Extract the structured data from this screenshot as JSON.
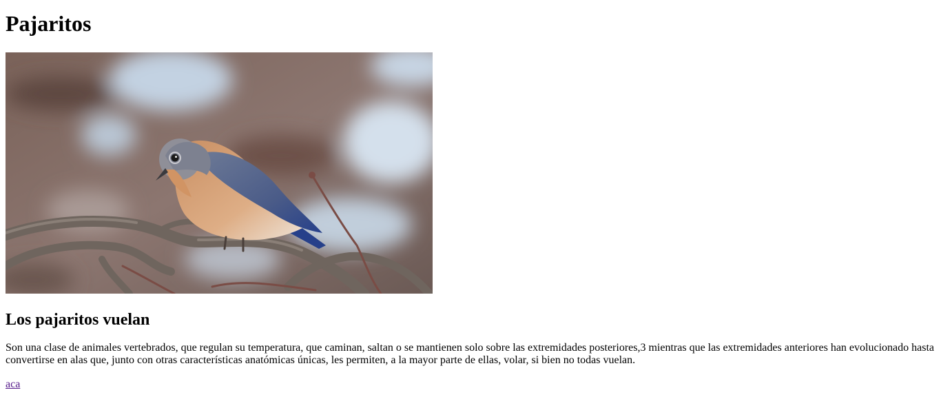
{
  "page": {
    "title": "Pajaritos",
    "image": {
      "icon": "bluebird-photo",
      "alt": "",
      "colors": {
        "background": "#8a7468",
        "sky": "#c9d6e3",
        "bird_blue": "#4b5f8e",
        "bird_orange": "#d3a27a",
        "branch": "#6e625a"
      }
    },
    "subtitle": "Los pajaritos vuelan",
    "paragraph": "Son una clase de animales vertebrados, que regulan su temperatura, que caminan, saltan o se mantienen solo sobre las extremidades posteriores,3 mientras que las extremidades anteriores han evolucionado hasta convertirse en alas que, junto con otras características anatómicas únicas, les permiten, a la mayor parte de ellas, volar, si bien no todas vuelan.",
    "link": "aca"
  }
}
